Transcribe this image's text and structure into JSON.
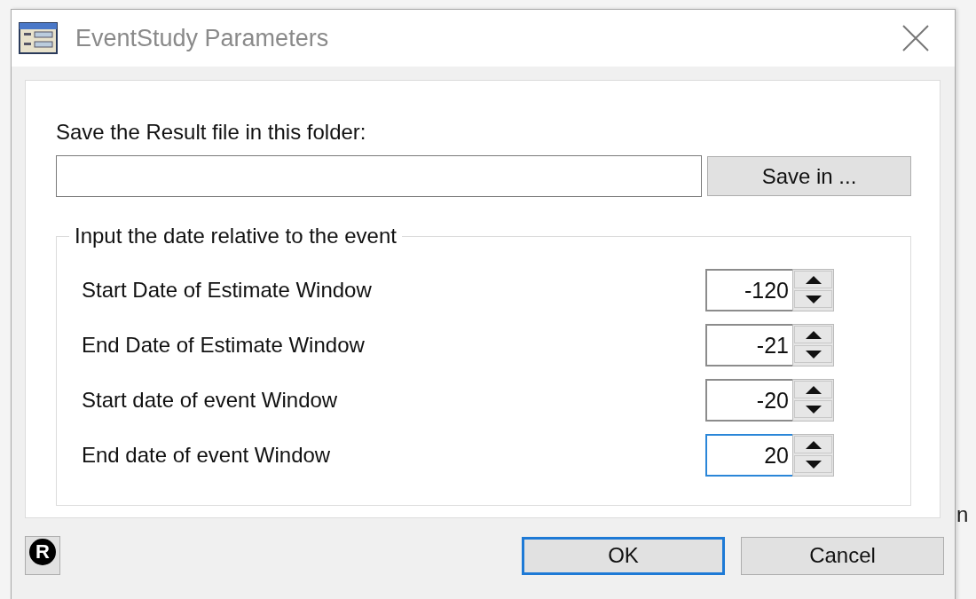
{
  "window": {
    "title": "EventStudy Parameters"
  },
  "folder": {
    "label": "Save the Result file in this folder:",
    "browse_button": "Save in ..."
  },
  "group": {
    "title": "Input the date relative to the event",
    "fields": [
      {
        "label": "Start Date of Estimate Window",
        "value": "-120",
        "focused": false
      },
      {
        "label": "End Date of Estimate Window",
        "value": "-21",
        "focused": false
      },
      {
        "label": "Start date of event Window",
        "value": "-20",
        "focused": false
      },
      {
        "label": "End date of event Window",
        "value": "20",
        "focused": true
      }
    ]
  },
  "buttons": [
    {
      "label": "OK",
      "default": true
    },
    {
      "label": "Cancel",
      "default": false
    }
  ],
  "logo_letter": "R",
  "background_text": "n"
}
